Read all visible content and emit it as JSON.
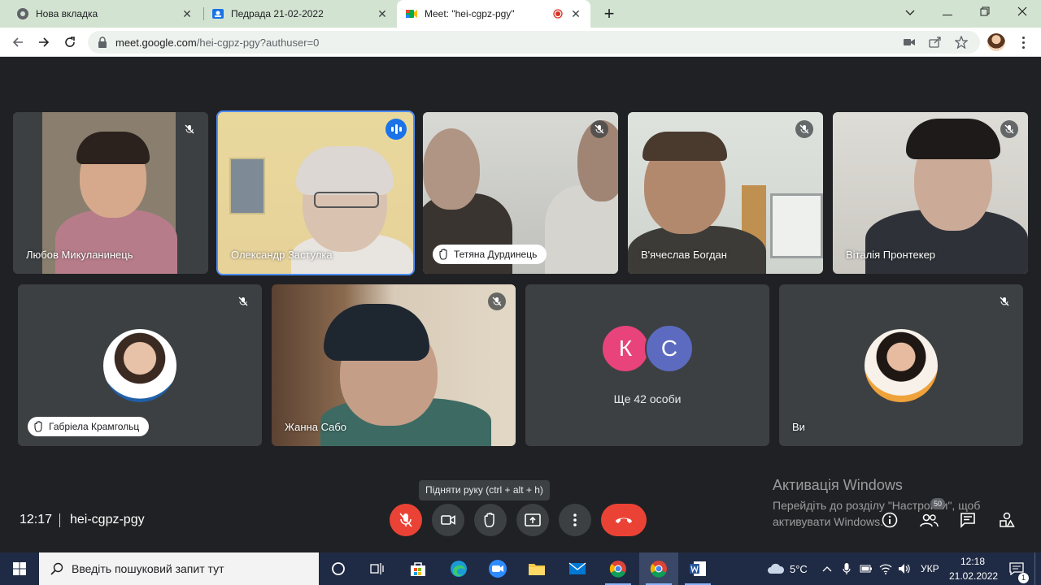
{
  "browser": {
    "tabs": [
      {
        "title": "Нова вкладка",
        "favicon": "chrome-icon"
      },
      {
        "title": "Педрада 21-02-2022",
        "favicon": "google-classroom-icon"
      },
      {
        "title": "Meet: \"hei-cgpz-pgy\"",
        "favicon": "google-meet-icon",
        "active": true,
        "recording": true
      }
    ],
    "url_host": "meet.google.com",
    "url_path": "/hei-cgpz-pgy?authuser=0"
  },
  "meet": {
    "participants_row1": [
      {
        "name": "Любов Микуланинець",
        "mic_muted": true
      },
      {
        "name": "Олександр Застулка",
        "speaking": true
      },
      {
        "name": "Тетяна Дурдинець",
        "hand_raised": true,
        "mic_muted": true
      },
      {
        "name": "В'ячеслав Богдан",
        "mic_muted": true
      },
      {
        "name": "Віталія Пронтекер",
        "mic_muted": true
      }
    ],
    "participants_row2": [
      {
        "name": "Габріела Крамгольц",
        "hand_raised": true,
        "mic_muted": true
      },
      {
        "name": "Жанна Сабо",
        "mic_muted": true
      },
      {
        "name": "Ще 42 особи",
        "avatars": [
          "К",
          "С"
        ]
      },
      {
        "name": "Ви",
        "mic_muted": true
      }
    ],
    "time": "12:17",
    "meeting_code": "hei-cgpz-pgy",
    "tooltip": "Підняти руку (ctrl + alt + h)",
    "people_count": "50",
    "colors": {
      "end_call": "#ea4335",
      "avatar_k": "#e8437a",
      "avatar_c": "#5c6bc0",
      "speaking": "#4c8df6"
    }
  },
  "watermark": {
    "line1": "Активація Windows",
    "line2": "Перейдіть до розділу \"Настройки\", щоб",
    "line3": "активувати Windows."
  },
  "taskbar": {
    "search_placeholder": "Введіть пошуковий запит тут",
    "weather": "5°C",
    "language": "УКР",
    "time": "12:18",
    "date": "21.02.2022",
    "notifications": "1"
  }
}
